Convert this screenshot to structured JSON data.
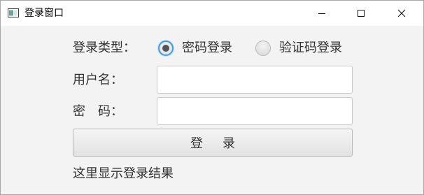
{
  "window": {
    "title": "登录窗口",
    "icon": "app-window-icon",
    "controls": [
      "minimize-icon",
      "maximize-icon",
      "close-icon"
    ]
  },
  "form": {
    "login_type_label": "登录类型：",
    "login_types": [
      {
        "label": "密码登录",
        "selected": true
      },
      {
        "label": "验证码登录",
        "selected": false
      }
    ],
    "username_label": "用户名：",
    "username_value": "",
    "password_label": "密　码：",
    "password_value": "",
    "login_button_label": "登录",
    "result_text": "这里显示登录结果"
  },
  "colors": {
    "background": "#f3f3f3",
    "radio_accent": "#3c9fe0",
    "text": "#333333"
  }
}
